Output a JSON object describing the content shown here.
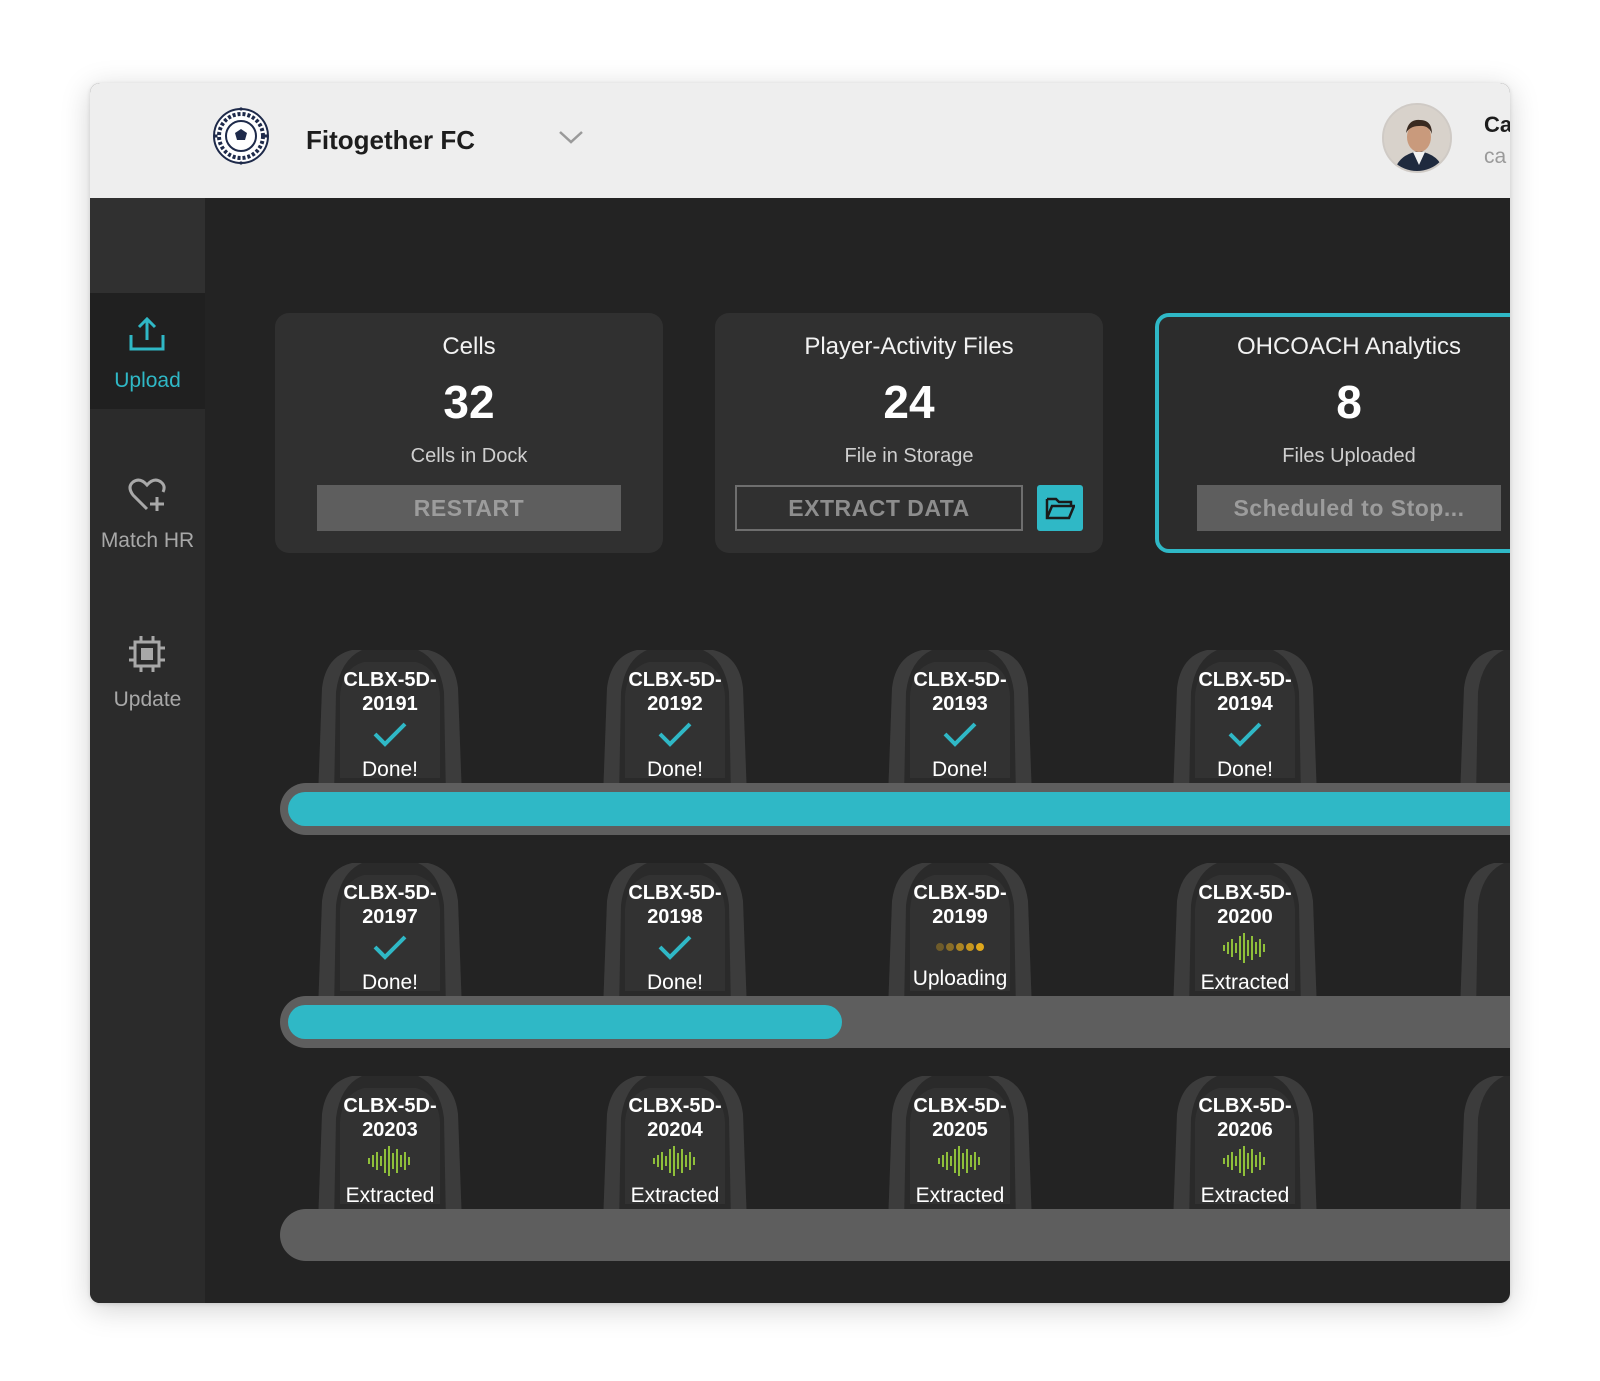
{
  "header": {
    "team_name": "Fitogether FC",
    "user_name": "Ca",
    "user_email": "ca"
  },
  "sidebar": {
    "items": [
      {
        "label": "Upload",
        "icon": "upload-icon",
        "active": true
      },
      {
        "label": "Match HR",
        "icon": "heart-plus-icon",
        "active": false
      },
      {
        "label": "Update",
        "icon": "chip-icon",
        "active": false
      }
    ]
  },
  "cards": [
    {
      "title": "Cells",
      "value": "32",
      "subtitle": "Cells in Dock",
      "button": "RESTART"
    },
    {
      "title": "Player-Activity Files",
      "value": "24",
      "subtitle": "File in Storage",
      "button": "EXTRACT DATA"
    },
    {
      "title": "OHCOACH Analytics",
      "value": "8",
      "subtitle": "Files Uploaded",
      "button": "Scheduled to Stop..."
    }
  ],
  "rows": [
    {
      "progress": 1.0,
      "cells": [
        {
          "id_line1": "CLBX-5D-",
          "id_line2": "20191",
          "status": "Done!",
          "icon": "check-icon"
        },
        {
          "id_line1": "CLBX-5D-",
          "id_line2": "20192",
          "status": "Done!",
          "icon": "check-icon"
        },
        {
          "id_line1": "CLBX-5D-",
          "id_line2": "20193",
          "status": "Done!",
          "icon": "check-icon"
        },
        {
          "id_line1": "CLBX-5D-",
          "id_line2": "20194",
          "status": "Done!",
          "icon": "check-icon"
        }
      ]
    },
    {
      "progress": 0.45,
      "cells": [
        {
          "id_line1": "CLBX-5D-",
          "id_line2": "20197",
          "status": "Done!",
          "icon": "check-icon"
        },
        {
          "id_line1": "CLBX-5D-",
          "id_line2": "20198",
          "status": "Done!",
          "icon": "check-icon"
        },
        {
          "id_line1": "CLBX-5D-",
          "id_line2": "20199",
          "status": "Uploading",
          "icon": "loading-dots-icon"
        },
        {
          "id_line1": "CLBX-5D-",
          "id_line2": "20200",
          "status": "Extracted",
          "icon": "waveform-icon"
        }
      ]
    },
    {
      "progress": 0,
      "cells": [
        {
          "id_line1": "CLBX-5D-",
          "id_line2": "20203",
          "status": "Extracted",
          "icon": "waveform-icon"
        },
        {
          "id_line1": "CLBX-5D-",
          "id_line2": "20204",
          "status": "Extracted",
          "icon": "waveform-icon"
        },
        {
          "id_line1": "CLBX-5D-",
          "id_line2": "20205",
          "status": "Extracted",
          "icon": "waveform-icon"
        },
        {
          "id_line1": "CLBX-5D-",
          "id_line2": "20206",
          "status": "Extracted",
          "icon": "waveform-icon"
        }
      ]
    }
  ],
  "colors": {
    "accent": "#2fb8c6",
    "waveform": "#8fbf3a",
    "loading": "#e0a81c",
    "background": "#232323",
    "card": "#303030"
  }
}
